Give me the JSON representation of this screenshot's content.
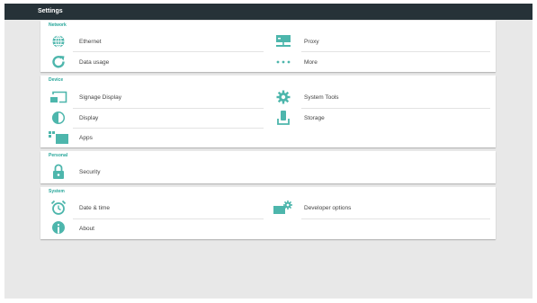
{
  "app": {
    "title": "Settings"
  },
  "colors": {
    "accent": "#26a69a",
    "titlebar": "#263238",
    "icon": "#4db6ac"
  },
  "sections": [
    {
      "header": "Network",
      "items": [
        {
          "label": "Ethernet",
          "icon": "globe-icon"
        },
        {
          "label": "Proxy",
          "icon": "network-icon"
        },
        {
          "label": "Data usage",
          "icon": "refresh-icon"
        },
        {
          "label": "More",
          "icon": "more-dots-icon"
        }
      ]
    },
    {
      "header": "Device",
      "items": [
        {
          "label": "Signage Display",
          "icon": "cast-display-icon"
        },
        {
          "label": "System Tools",
          "icon": "gear-icon"
        },
        {
          "label": "Display",
          "icon": "brightness-icon"
        },
        {
          "label": "Storage",
          "icon": "storage-icon"
        },
        {
          "label": "Apps",
          "icon": "apps-icon"
        }
      ]
    },
    {
      "header": "Personal",
      "items": [
        {
          "label": "Security",
          "icon": "lock-icon"
        }
      ]
    },
    {
      "header": "System",
      "items": [
        {
          "label": "Date & time",
          "icon": "alarm-clock-icon"
        },
        {
          "label": "Developer options",
          "icon": "developer-gear-icon"
        },
        {
          "label": "About",
          "icon": "info-icon"
        }
      ]
    }
  ]
}
